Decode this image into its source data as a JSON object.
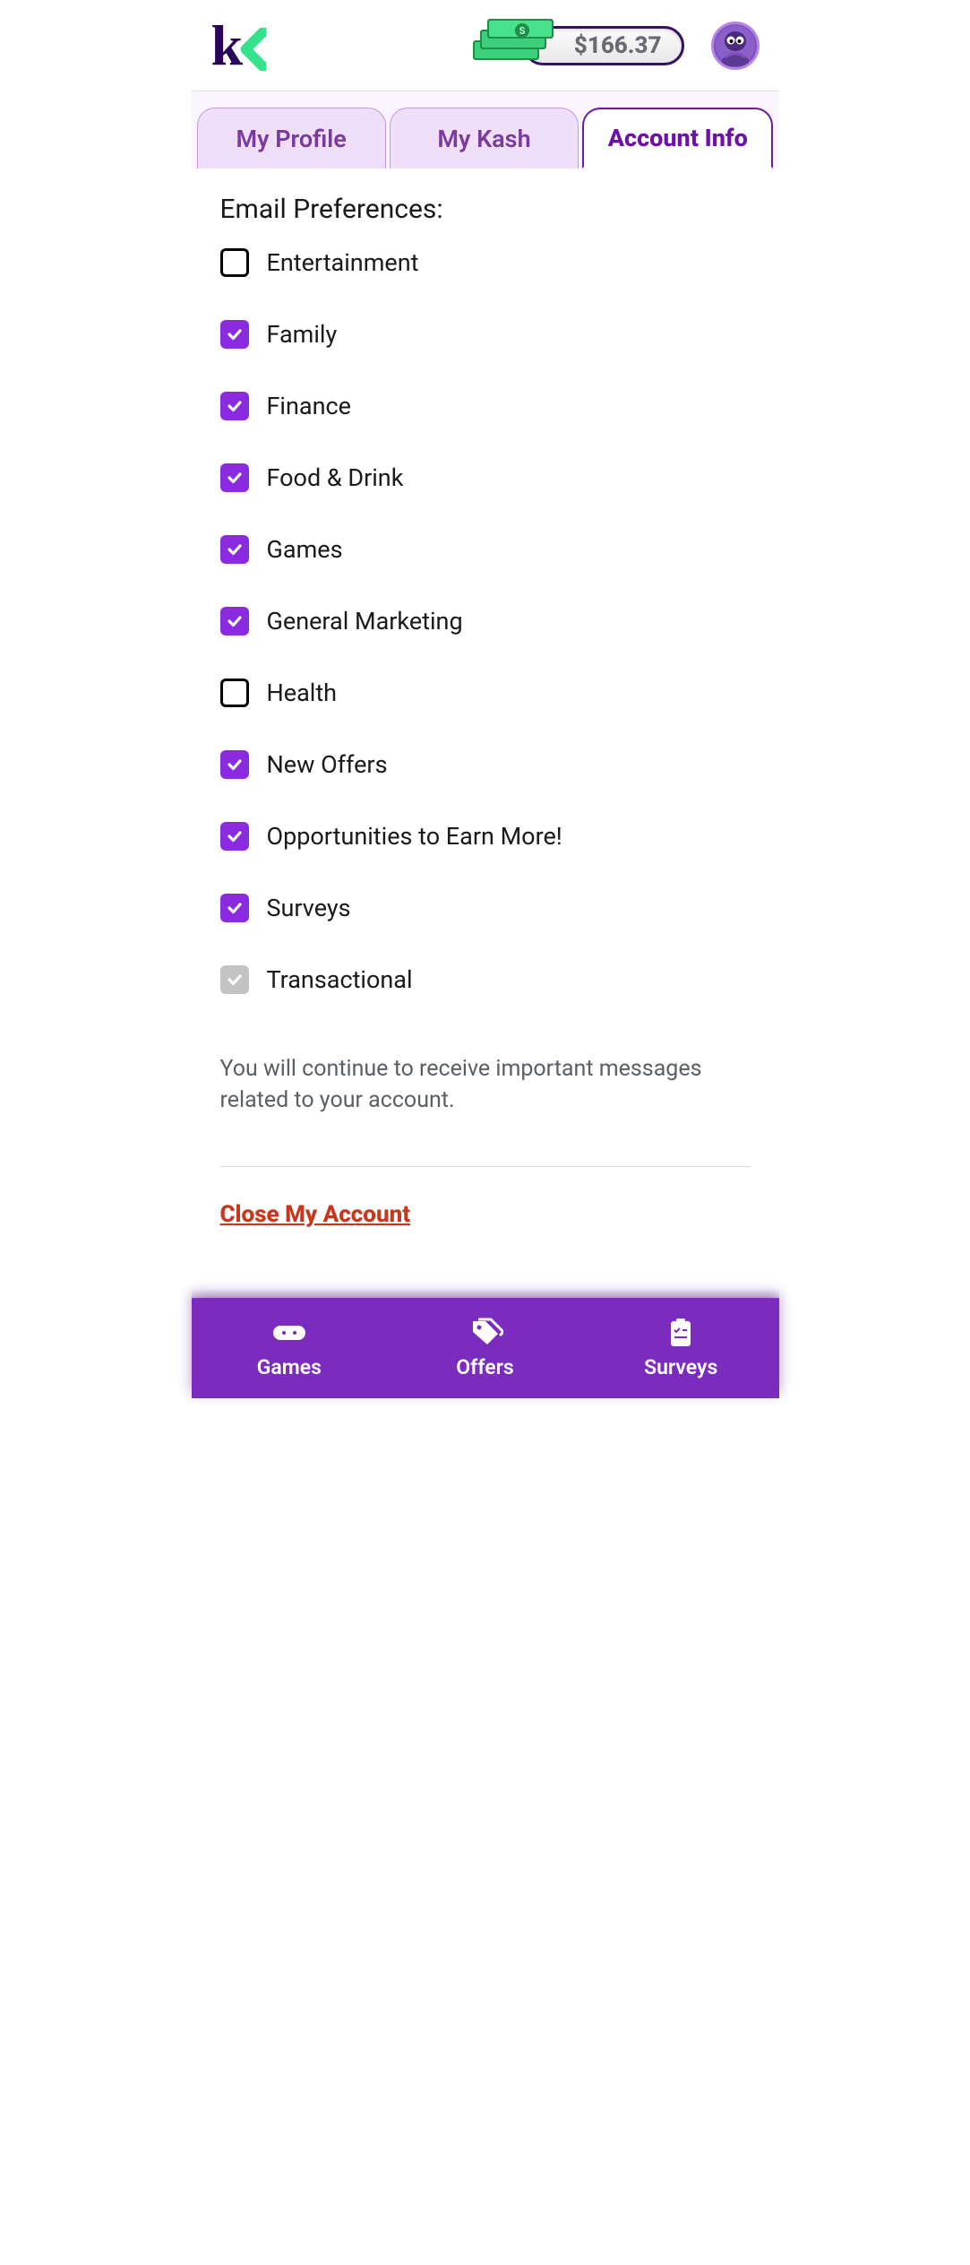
{
  "header": {
    "balance": "$166.37"
  },
  "tabs": {
    "profile": "My Profile",
    "kash": "My Kash",
    "account": "Account Info"
  },
  "section": {
    "title": "Email Preferences:",
    "note": "You will continue to receive important messages related to your account.",
    "close_link": "Close My Account"
  },
  "prefs": {
    "entertainment": {
      "label": "Entertainment",
      "checked": false,
      "disabled": false
    },
    "family": {
      "label": "Family",
      "checked": true,
      "disabled": false
    },
    "finance": {
      "label": "Finance",
      "checked": true,
      "disabled": false
    },
    "food": {
      "label": "Food & Drink",
      "checked": true,
      "disabled": false
    },
    "games": {
      "label": "Games",
      "checked": true,
      "disabled": false
    },
    "marketing": {
      "label": "General Marketing",
      "checked": true,
      "disabled": false
    },
    "health": {
      "label": "Health",
      "checked": false,
      "disabled": false
    },
    "offers": {
      "label": "New Offers",
      "checked": true,
      "disabled": false
    },
    "earn": {
      "label": "Opportunities to Earn More!",
      "checked": true,
      "disabled": false
    },
    "surveys": {
      "label": "Surveys",
      "checked": true,
      "disabled": false
    },
    "transactional": {
      "label": "Transactional",
      "checked": true,
      "disabled": true
    }
  },
  "nav": {
    "games": "Games",
    "offers": "Offers",
    "surveys": "Surveys"
  }
}
